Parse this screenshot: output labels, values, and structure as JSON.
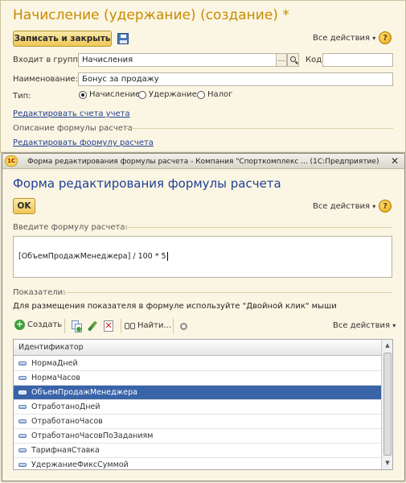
{
  "main": {
    "title": "Начисление (удержание) (создание) *",
    "save_close_label": "Записать и закрыть",
    "all_actions": "Все действия",
    "group_label": "Входит в группу:",
    "group_value": "Начисления",
    "code_label": "Код:",
    "code_value": "",
    "name_label": "Наименование:",
    "name_value": "Бонус за продажу",
    "type_label": "Тип:",
    "type_options": [
      "Начисление",
      "Удержание",
      "Налог"
    ],
    "edit_accounts_link": "Редактировать счета учета",
    "formula_section": "Описание формулы расчета",
    "edit_formula_link": "Редактировать формулу расчета"
  },
  "dialog": {
    "window_title": "Форма редактирования формулы расчета - Компания \"Спорткомплекс ... (1С:Предприятие)",
    "heading": "Форма редактирования формулы расчета",
    "ok_label": "OK",
    "all_actions": "Все действия",
    "formula_section": "Введите формулу расчета:",
    "formula_text": "[ОбъемПродажМенеджера] / 100 * 5",
    "indicators_section": "Показатели:",
    "hint": "Для размещения показателя в формуле используйте \"Двойной клик\" мыши",
    "toolbar": {
      "create": "Создать",
      "find": "Найти...",
      "all_actions": "Все действия"
    },
    "table": {
      "column": "Идентификатор",
      "rows": [
        "НормаДней",
        "НормаЧасов",
        "ОбъемПродажМенеджера",
        "ОтработаноДней",
        "ОтработаноЧасов",
        "ОтработаноЧасовПоЗаданиям",
        "ТарифнаяСтавка",
        "УдержаниеФиксСуммой"
      ],
      "selected_index": 2
    }
  },
  "colors": {
    "accent_title": "#c98a00",
    "selection": "#3a64a8",
    "link": "#1f3f97"
  },
  "icons": [
    "floppy-icon",
    "help-icon",
    "ellipsis-icon",
    "search-icon",
    "onec-logo-icon",
    "close-icon",
    "add-icon",
    "copy-icon",
    "edit-icon",
    "delete-icon",
    "binoculars-icon",
    "tools-icon"
  ]
}
